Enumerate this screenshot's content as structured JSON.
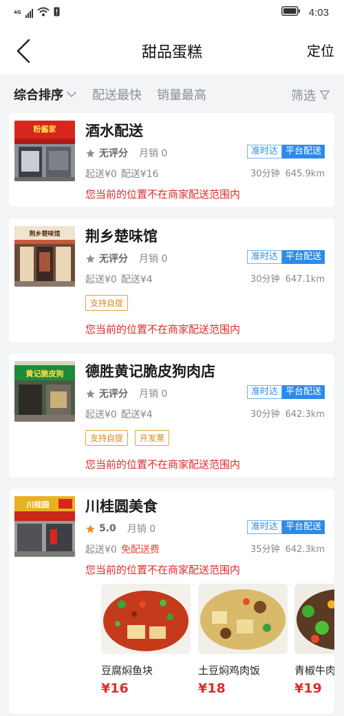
{
  "status_bar": {
    "network": "4G",
    "time": "4:03"
  },
  "header": {
    "title": "甜品蛋糕",
    "right_action": "定位"
  },
  "filters": {
    "sort_options": [
      "综合排序",
      "配送最快",
      "销量最高"
    ],
    "filter_label": "筛选"
  },
  "colors": {
    "accent_blue": "#2d8ae8",
    "warning_red": "#e02b2b",
    "tag_orange": "#d8891a",
    "star_orange": "#f08a24"
  },
  "shops": [
    {
      "name": "酒水配送",
      "rating": "无评分",
      "sales": "月销 0",
      "min_order": "起送¥0",
      "delivery_fee": "配送¥16",
      "badge_ontime": "准时达",
      "badge_platform": "平台配送",
      "delivery_time": "30分钟",
      "distance": "645.9km",
      "tags": [],
      "warning": "您当前的位置不在商家配送范围内",
      "sign_text": "粉酱家"
    },
    {
      "name": "荆乡楚味馆",
      "rating": "无评分",
      "sales": "月销 0",
      "min_order": "起送¥0",
      "delivery_fee": "配送¥4",
      "badge_ontime": "准时达",
      "badge_platform": "平台配送",
      "delivery_time": "30分钟",
      "distance": "647.1km",
      "tags": [
        "支持自提"
      ],
      "warning": "您当前的位置不在商家配送范围内",
      "sign_text": "荆乡楚味馆"
    },
    {
      "name": "德胜黄记脆皮狗肉店",
      "rating": "无评分",
      "sales": "月销 0",
      "min_order": "起送¥0",
      "delivery_fee": "配送¥4",
      "badge_ontime": "准时达",
      "badge_platform": "平台配送",
      "delivery_time": "30分钟",
      "distance": "642.3km",
      "tags": [
        "支持自提",
        "开发票"
      ],
      "warning": "您当前的位置不在商家配送范围内",
      "sign_text": "黄记脆皮狗"
    },
    {
      "name": "川桂圆美食",
      "rating": "5.0",
      "sales": "月销 0",
      "min_order": "起送¥0",
      "delivery_fee": "免配送费",
      "badge_ontime": "准时达",
      "badge_platform": "平台配送",
      "delivery_time": "35分钟",
      "distance": "642.3km",
      "tags": [],
      "warning": "您当前的位置不在商家配送范围内",
      "sign_text": "川桂园",
      "dishes": [
        {
          "name": "豆腐焖鱼块",
          "price": "¥16"
        },
        {
          "name": "土豆焖鸡肉饭",
          "price": "¥18"
        },
        {
          "name": "青椒牛肉",
          "price": "¥19"
        }
      ]
    }
  ]
}
